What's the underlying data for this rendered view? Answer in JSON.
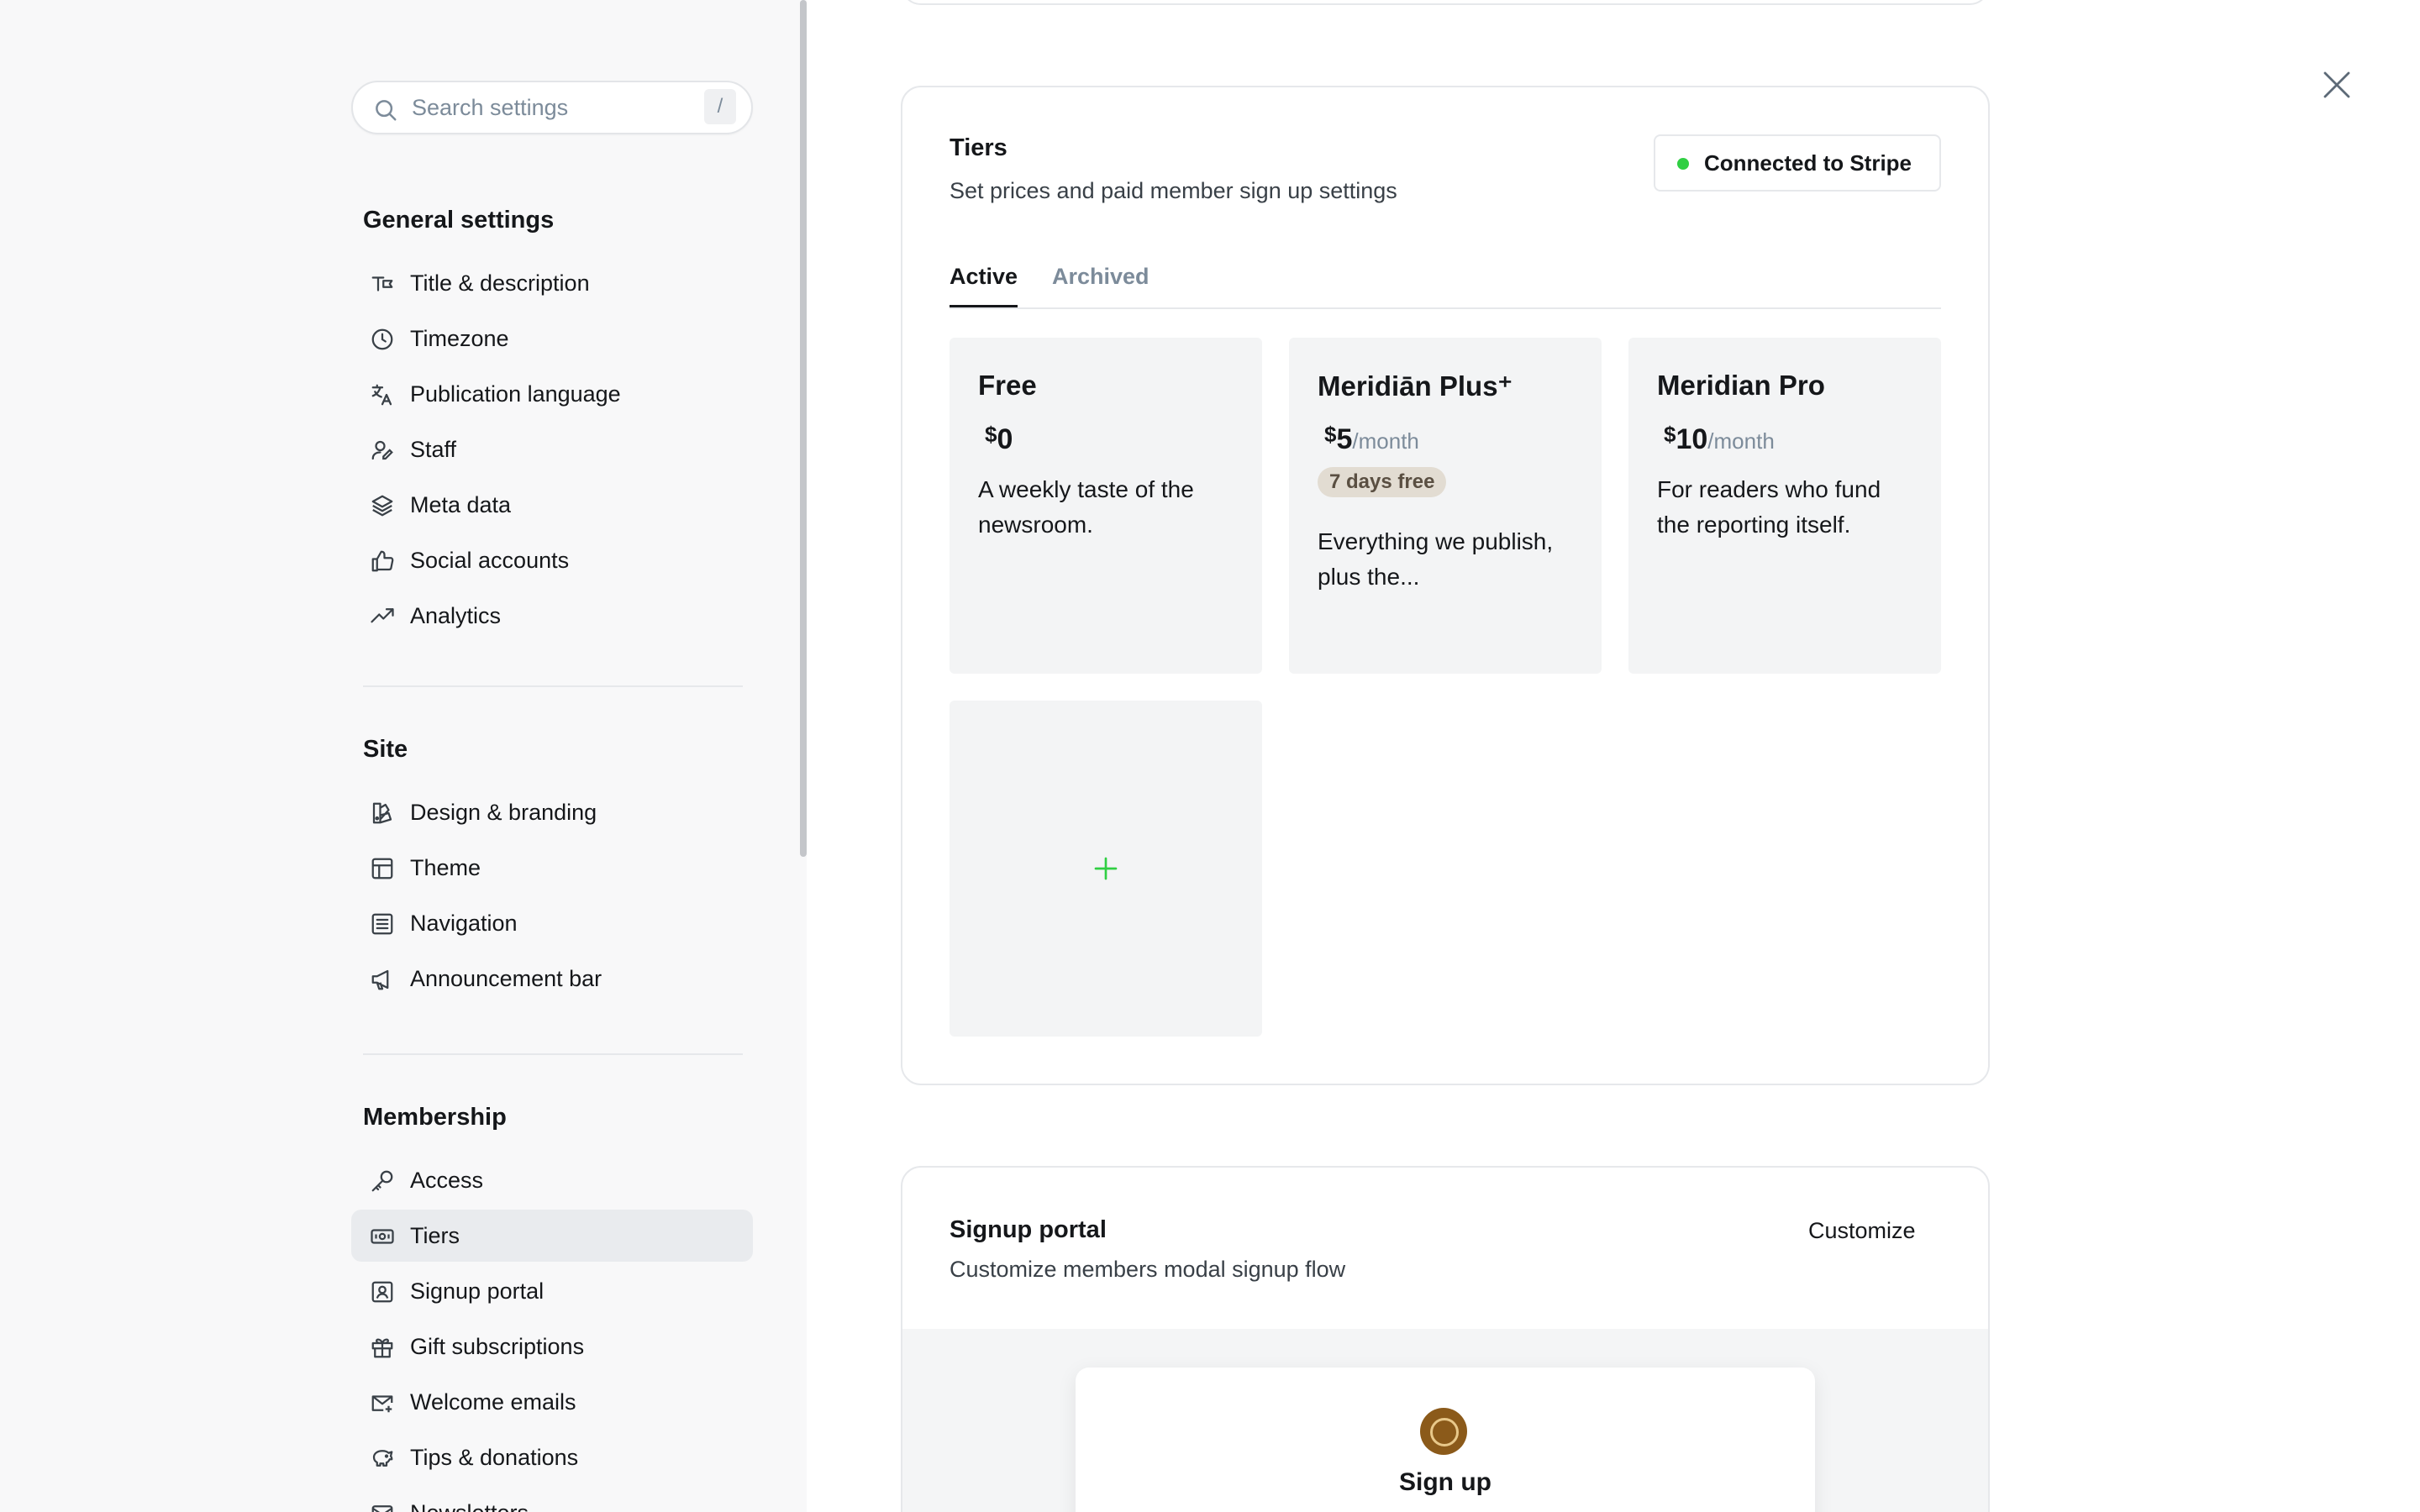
{
  "sidebar": {
    "search": {
      "placeholder": "Search settings",
      "shortcut": "/"
    },
    "groups": [
      {
        "title": "General settings",
        "items": [
          {
            "label": "Title & description",
            "icon": "text-icon"
          },
          {
            "label": "Timezone",
            "icon": "clock-icon"
          },
          {
            "label": "Publication language",
            "icon": "translate-icon"
          },
          {
            "label": "Staff",
            "icon": "users-icon"
          },
          {
            "label": "Meta data",
            "icon": "layers-icon"
          },
          {
            "label": "Social accounts",
            "icon": "thumbs-up-icon"
          },
          {
            "label": "Analytics",
            "icon": "trend-up-icon"
          }
        ]
      },
      {
        "title": "Site",
        "items": [
          {
            "label": "Design & branding",
            "icon": "palette-icon"
          },
          {
            "label": "Theme",
            "icon": "layout-icon"
          },
          {
            "label": "Navigation",
            "icon": "list-icon"
          },
          {
            "label": "Announcement bar",
            "icon": "megaphone-icon"
          }
        ]
      },
      {
        "title": "Membership",
        "items": [
          {
            "label": "Access",
            "icon": "key-icon"
          },
          {
            "label": "Tiers",
            "icon": "ticket-icon",
            "active": true
          },
          {
            "label": "Signup portal",
            "icon": "portal-icon"
          },
          {
            "label": "Gift subscriptions",
            "icon": "gift-icon"
          },
          {
            "label": "Welcome emails",
            "icon": "mail-icon"
          },
          {
            "label": "Tips & donations",
            "icon": "piggy-bank-icon"
          },
          {
            "label": "Newsletters",
            "icon": "newsletter-icon"
          }
        ]
      }
    ]
  },
  "tiers_section": {
    "title": "Tiers",
    "subtitle": "Set prices and paid member sign up settings",
    "stripe_status": "Connected to Stripe",
    "stripe_color": "#30cf43",
    "tabs": [
      {
        "label": "Active",
        "active": true
      },
      {
        "label": "Archived",
        "active": false
      }
    ],
    "tiers": [
      {
        "name": "Free",
        "currency": "$",
        "amount": "0",
        "period": "",
        "trial": "",
        "description": "A weekly taste of the newsroom."
      },
      {
        "name": "Meridiān Plus⁺",
        "currency": "$",
        "amount": "5",
        "period": "/month",
        "trial": "7 days free",
        "description": "Everything we publish, plus the..."
      },
      {
        "name": "Meridian Pro",
        "currency": "$",
        "amount": "10",
        "period": "/month",
        "trial": "",
        "description": "For readers who fund the reporting itself."
      }
    ],
    "add_tier_icon": "plus-icon",
    "accent_color": "#30cf43"
  },
  "signup_portal": {
    "title": "Signup portal",
    "subtitle": "Customize members modal signup flow",
    "customize_label": "Customize",
    "preview_heading": "Sign up"
  }
}
